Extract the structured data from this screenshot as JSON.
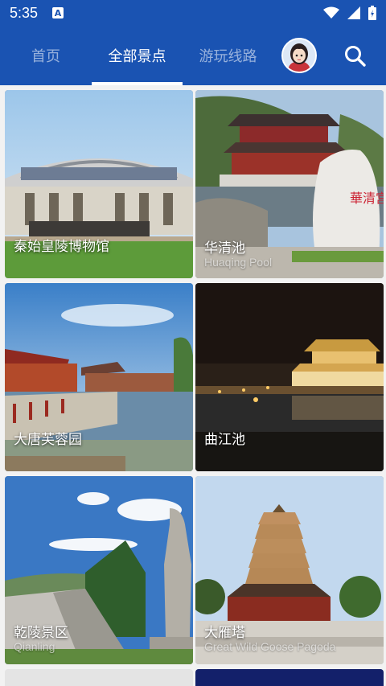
{
  "status_bar": {
    "time": "5:35",
    "notification_icon": "a-notification-icon",
    "icons": [
      "wifi-icon",
      "signal-icon",
      "battery-icon"
    ]
  },
  "tabs": [
    {
      "label": "首页",
      "active": false
    },
    {
      "label": "全部景点",
      "active": true
    },
    {
      "label": "游玩线路",
      "active": false
    }
  ],
  "header": {
    "avatar_icon": "user-avatar",
    "search_icon": "search-icon"
  },
  "attractions": [
    {
      "name": "秦始皇陵博物馆",
      "subtitle": ""
    },
    {
      "name": "华清池",
      "subtitle": "Huaqing Pool"
    },
    {
      "name": "大唐芙蓉园",
      "subtitle": ""
    },
    {
      "name": "曲江池",
      "subtitle": ""
    },
    {
      "name": "乾陵景区",
      "subtitle": "Qianling"
    },
    {
      "name": "大雁塔",
      "subtitle": "Great Wild Goose Pagoda"
    }
  ],
  "colors": {
    "primary": "#1a53b2",
    "background": "#f2f2f2"
  }
}
